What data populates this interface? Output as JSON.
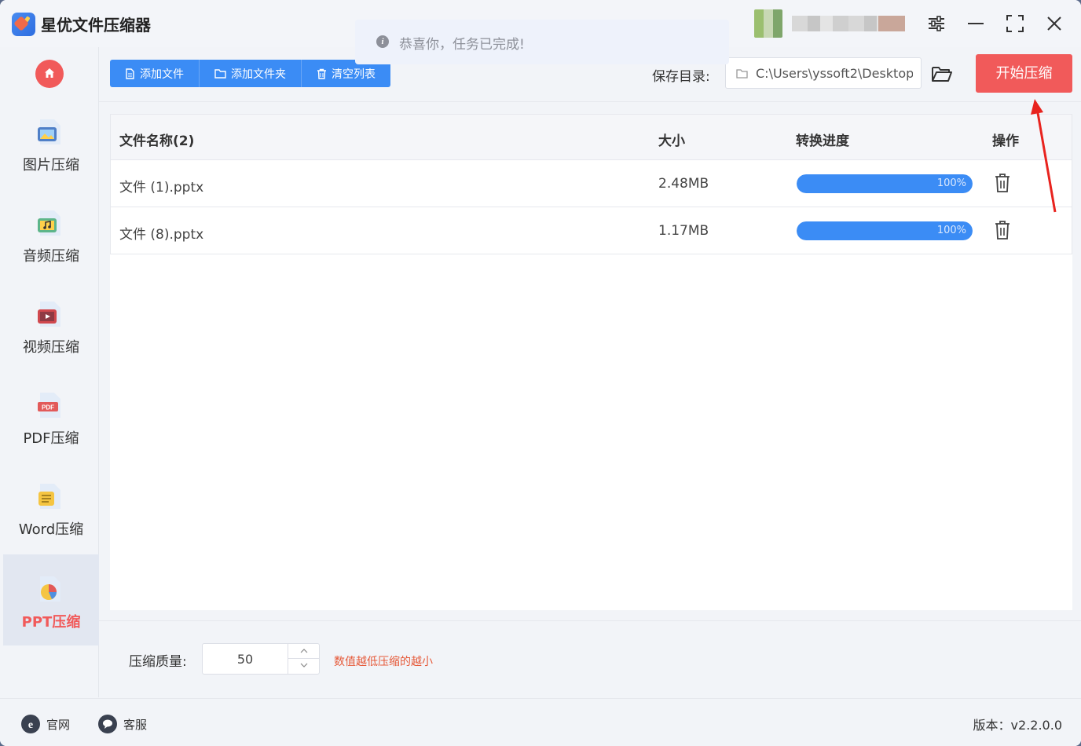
{
  "app": {
    "title": "星优文件压缩器"
  },
  "toast": {
    "text": "恭喜你，任务已完成!",
    "icon": "info-icon"
  },
  "window_controls": [
    "settings-icon",
    "minimize-icon",
    "maximize-icon",
    "close-icon"
  ],
  "sidebar": {
    "items": [
      {
        "label": "图片压缩",
        "icon": "image-file-icon"
      },
      {
        "label": "音频压缩",
        "icon": "audio-file-icon"
      },
      {
        "label": "视频压缩",
        "icon": "video-file-icon"
      },
      {
        "label": "PDF压缩",
        "icon": "pdf-file-icon"
      },
      {
        "label": "Word压缩",
        "icon": "word-file-icon"
      },
      {
        "label": "PPT压缩",
        "icon": "ppt-file-icon",
        "active": true
      }
    ]
  },
  "toolbar": {
    "add_file": "添加文件",
    "add_folder": "添加文件夹",
    "clear_list": "清空列表",
    "save_dir_label": "保存目录:",
    "save_dir_value": "C:\\Users\\yssoft2\\Desktop\\",
    "start_button": "开始压缩"
  },
  "table": {
    "headers": [
      "文件名称(2)",
      "大小",
      "转换进度",
      "操作"
    ],
    "rows": [
      {
        "name": "文件 (1).pptx",
        "size": "2.48MB",
        "progress": 100,
        "progress_label": "100%"
      },
      {
        "name": "文件 (8).pptx",
        "size": "1.17MB",
        "progress": 100,
        "progress_label": "100%"
      }
    ]
  },
  "settings": {
    "quality_label": "压缩质量:",
    "quality_value": "50",
    "hint": "数值越低压缩的越小"
  },
  "footer": {
    "website": "官网",
    "support": "客服",
    "version": "版本：v2.2.0.0"
  },
  "colors": {
    "accent_blue": "#3b8cf5",
    "accent_red": "#f15a5a",
    "hint_orange": "#e65a3a"
  }
}
